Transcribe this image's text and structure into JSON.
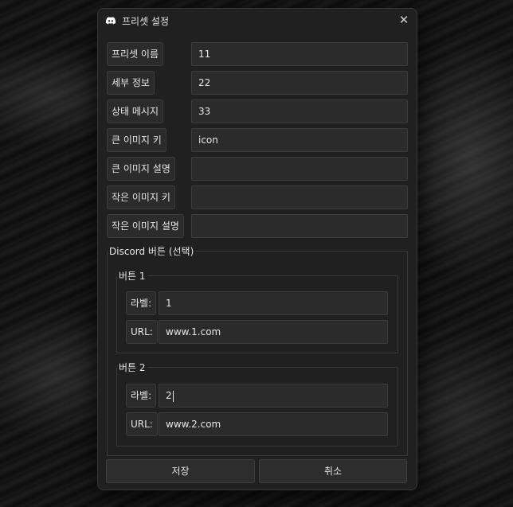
{
  "window": {
    "title": "프리셋 설정",
    "icon": "discord-icon",
    "close_icon": "close-icon"
  },
  "fields": [
    {
      "label": "프리셋 이름",
      "value": "11"
    },
    {
      "label": "세부 정보",
      "value": "22"
    },
    {
      "label": "상태 메시지",
      "value": "33"
    },
    {
      "label": "큰 이미지 키",
      "value": "icon"
    },
    {
      "label": "큰 이미지 설명",
      "value": ""
    },
    {
      "label": "작은 이미지 키",
      "value": ""
    },
    {
      "label": "작은 이미지 설명",
      "value": ""
    }
  ],
  "buttons_group": {
    "title": "Discord 버튼 (선택)",
    "button1": {
      "title": "버튼 1",
      "label_caption": "라벨:",
      "label_value": "1",
      "url_caption": "URL:",
      "url_value": "www.1.com"
    },
    "button2": {
      "title": "버튼 2",
      "label_caption": "라벨:",
      "label_value": "2",
      "url_caption": "URL:",
      "url_value": "www.2.com"
    }
  },
  "actions": {
    "save": "저장",
    "cancel": "취소"
  },
  "colors": {
    "window_bg": "#202020",
    "field_bg": "#2b2b2b",
    "border": "#3c3c3c",
    "text": "#e6e6e6"
  }
}
